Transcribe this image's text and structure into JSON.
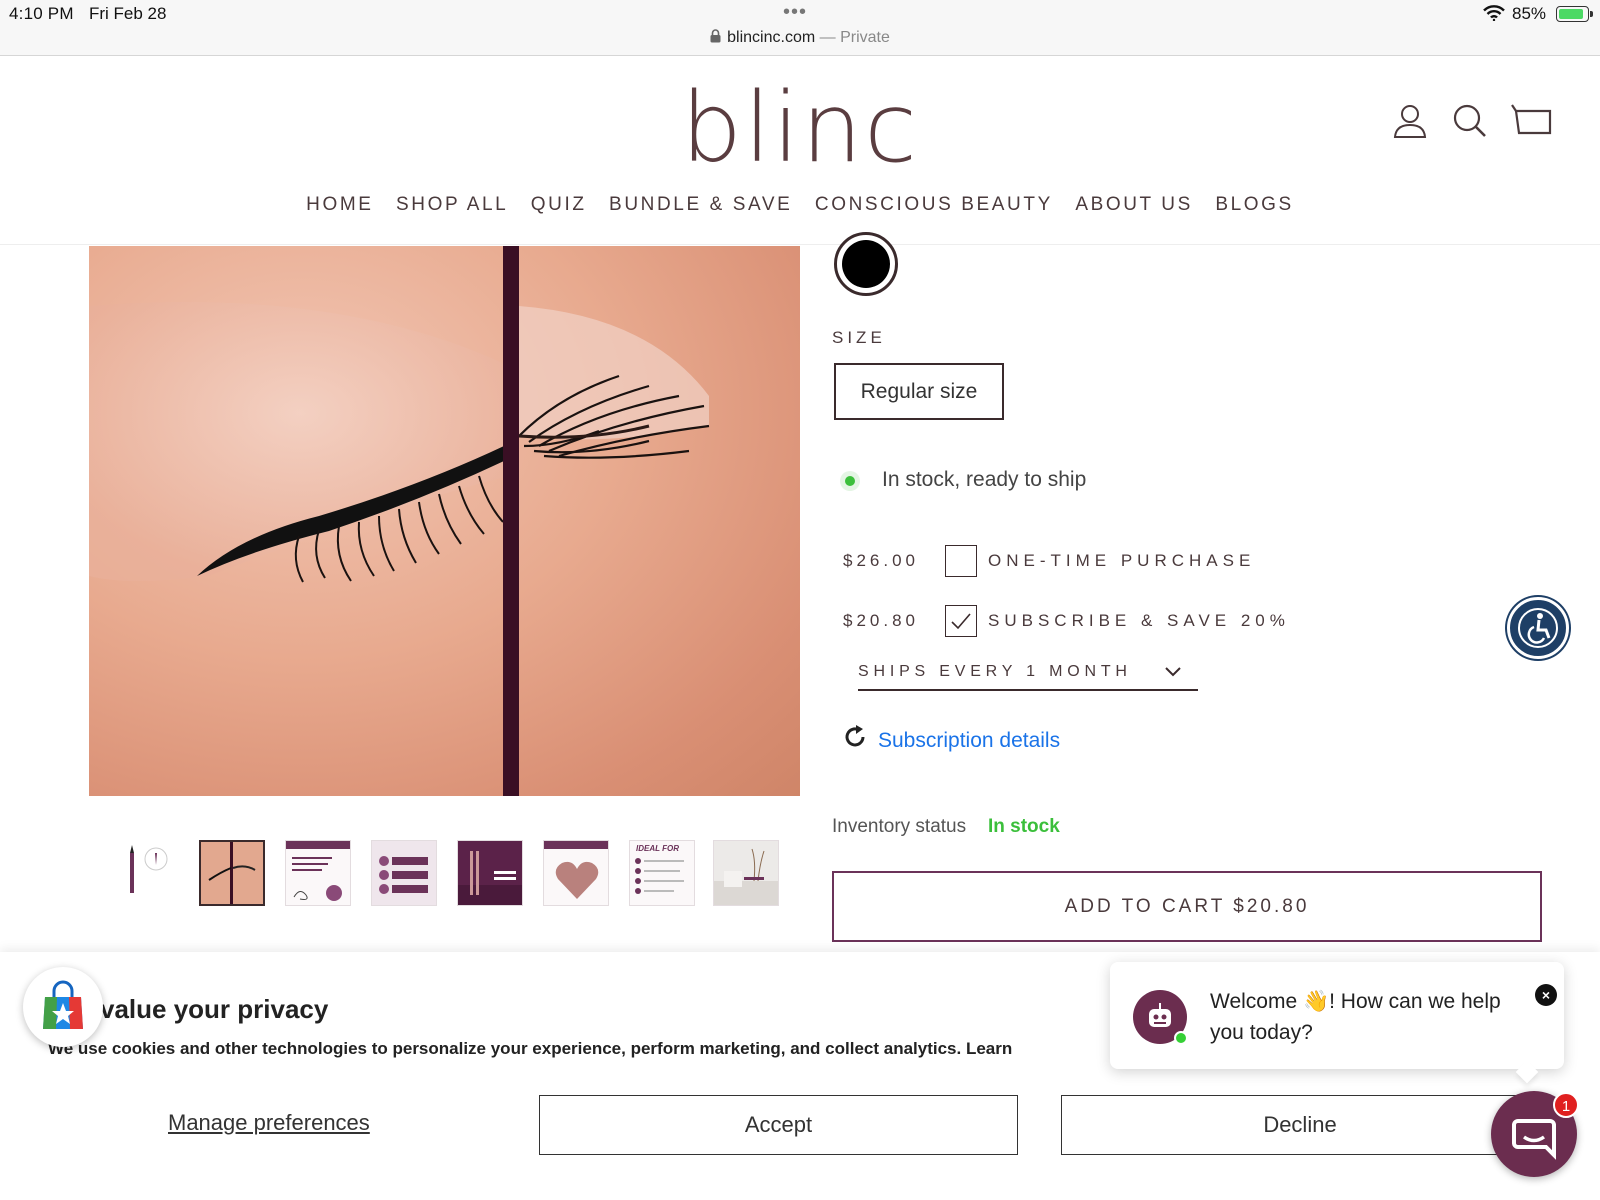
{
  "status_bar": {
    "time": "4:10 PM",
    "date": "Fri Feb 28",
    "url": "blincinc.com",
    "url_suffix": " — Private",
    "battery": "85%"
  },
  "header": {
    "logo": "blinc",
    "nav": [
      "HOME",
      "SHOP ALL",
      "QUIZ",
      "BUNDLE & SAVE",
      "CONSCIOUS BEAUTY",
      "ABOUT US",
      "BLOGS"
    ],
    "icons": [
      "account-icon",
      "search-icon",
      "cart-icon"
    ]
  },
  "product": {
    "swatch_color": "#000000",
    "size_label": "SIZE",
    "size_option": "Regular size",
    "stock_text": "In stock, ready to ship",
    "purchase_options": [
      {
        "price": "$26.00",
        "label": "ONE-TIME PURCHASE",
        "checked": false
      },
      {
        "price": "$20.80",
        "label": "SUBSCRIBE & SAVE 20%",
        "checked": true
      }
    ],
    "ships_select": "SHIPS EVERY 1 MONTH",
    "subscription_link": "Subscription details",
    "inventory_label": "Inventory status",
    "inventory_value": "In stock",
    "add_to_cart": "ADD TO CART $20.80",
    "thumbnail_texts": [
      "IDEAL FOR"
    ]
  },
  "privacy": {
    "title": "value your privacy",
    "text": "We use cookies and other technologies to personalize your experience, perform marketing, and collect analytics. Learn",
    "manage": "Manage preferences",
    "accept": "Accept",
    "decline": "Decline"
  },
  "chat": {
    "message": "Welcome 👋! How can we help you today?",
    "unread": "1"
  },
  "colors": {
    "brand": "#5a3d40",
    "accent_plum": "#6b3259",
    "in_stock_green": "#3bbf3b",
    "link_blue": "#1a73e8"
  }
}
